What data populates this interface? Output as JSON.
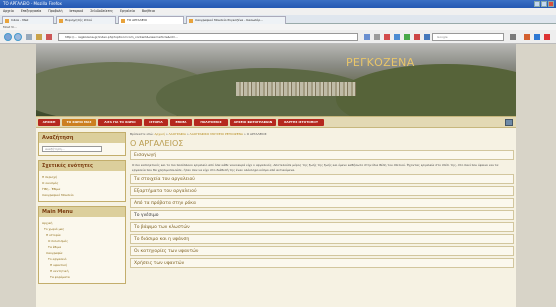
{
  "window": {
    "title": "ΤΟ ΑΡΓΑΛΕΙΟ - Mozilla Firefox"
  },
  "menubar": {
    "items": [
      "Αρχείο",
      "Επεξεργασία",
      "Προβολή",
      "Ιστορικό",
      "Σελιδοδείκτες",
      "Εργαλεία",
      "Βοήθεια"
    ]
  },
  "tabs": [
    {
      "label": "Inbox - Mail"
    },
    {
      "label": "Περιηγητής Ιστού"
    },
    {
      "label": "ΤΟ ΑΡΓΑΛΕΙΟ"
    },
    {
      "label": "Λαογραφικό Μουσείο Ρεγκοζένα - Καλωσόρ..."
    }
  ],
  "bookmarks": {
    "label": "Most Vi..."
  },
  "address": {
    "url": "http://... regkozena.gr/index.php?option=com_content&view=article&id=..."
  },
  "search": {
    "placeholder": "Google"
  },
  "site": {
    "title": "ΡΕΓΚΟΖΕΝΑ",
    "nav": [
      "ΑΡΧΙΚΗ",
      "ΤΟ ΧΩΡΙΟ ΜΑΣ",
      "ΛΙΓΑ ΓΙΑ ΤΟ ΧΩΡΙΟ",
      "ΙΣΤΟΡΙΑ",
      "ΕΘΙΜΑ",
      "ΠΟΛΙΤΙΣΜΟΣ",
      "ΑΡΧΕΙΟ ΦΩΤΟΓΡΑΦΙΩΝ",
      "ΧΑΡΤΗΣ ΙΣΤΟΤΟΠΟΥ"
    ]
  },
  "sidebar": {
    "search_title": "Αναζήτηση",
    "search_placeholder": "αναζήτηση...",
    "related_title": "Σχετικές ενότητες",
    "related_links": [
      "Η περιοχή",
      "Ο οικισμός",
      "Ήθη - Έθιμα",
      "Λαογραφικό Μουσείο"
    ],
    "menu_title": "Main Menu",
    "menu_links": [
      "Αρχική",
      "Το χωριό μας",
      "Η ιστορία",
      "Ο πολιτισμός",
      "Τα έθιμα",
      "Λαογραφία",
      "Το αργαλειό",
      "Η υφαντική",
      "Η κεντητική",
      "Τα φορέματα"
    ]
  },
  "main": {
    "breadcrumb_prefix": "Βρίσκεστε εδώ:",
    "breadcrumb": [
      "Αρχική",
      "ΛΑΟΓΡΑΦΙΑ",
      "ΛΑΟΓΡΑΦΙΚΟ ΜΟΥΣΕΙΟ ΡΕΓΚΟΖΕΝΑ",
      "Ο ΑΡΓΑΛΕΙΟΣ"
    ],
    "title": "Ο ΑΡΓΑΛΕΙΟΣ",
    "intro": "Εισαγωγή",
    "paragraph": "Ο πιο εκπληκτικός και το πιο πολύπλοκο εργαλείο από όσα κάθε νοικοκυρά είχε ο αργαλειός. Αποτελούσε μέρος της ζωής της ζωής και έμενε καθήλωτο στην ίδια θέση του σπιτιού. Έχοντας εργαλεία στο σπίτι της, στο πανί που ύφαινε και τα εργαλεία που θα χρησιμοποιούσε, ήταν σαν να είχε στο διάθεσή της έναν ολόκληρο κόσμο από αντικείμενα.",
    "rows": [
      "Τα στοιχεία του αργαλειού",
      "Εξαρτήματα του αργαλειού",
      "Από τα πρόβατα στην ρόκα",
      "Το γνέσιμο",
      "Το βάψιμο των κλωστών",
      "Το διάσιμο και η υφάνση",
      "Οι κατηγορίες των υφαντών",
      "Χρήσεις των υφαντών"
    ]
  }
}
